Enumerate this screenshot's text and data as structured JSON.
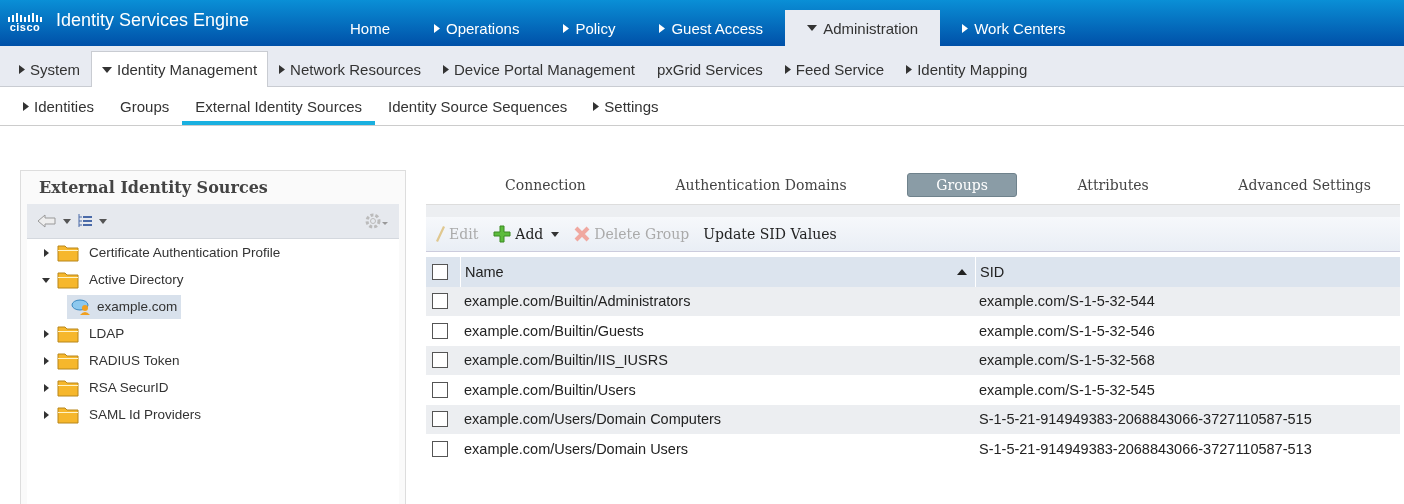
{
  "brand": {
    "logo": "cisco",
    "title": "Identity Services Engine"
  },
  "top_nav": [
    {
      "label": "Home",
      "selected": false
    },
    {
      "label": "Operations",
      "expanded": false,
      "selected": false
    },
    {
      "label": "Policy",
      "expanded": false,
      "selected": false
    },
    {
      "label": "Guest Access",
      "expanded": false,
      "selected": false
    },
    {
      "label": "Administration",
      "expanded": true,
      "selected": true
    },
    {
      "label": "Work Centers",
      "expanded": false,
      "selected": false
    }
  ],
  "second_nav": [
    {
      "label": "System",
      "expanded": false,
      "selected": false
    },
    {
      "label": "Identity Management",
      "expanded": true,
      "selected": true
    },
    {
      "label": "Network Resources",
      "expanded": false,
      "selected": false
    },
    {
      "label": "Device Portal Management",
      "expanded": false,
      "selected": false
    },
    {
      "label": "pxGrid Services",
      "selected": false
    },
    {
      "label": "Feed Service",
      "expanded": false,
      "selected": false
    },
    {
      "label": "Identity Mapping",
      "expanded": false,
      "selected": false
    }
  ],
  "third_nav": [
    {
      "label": "Identities",
      "expanded": false,
      "selected": false
    },
    {
      "label": "Groups",
      "selected": false
    },
    {
      "label": "External Identity Sources",
      "selected": true
    },
    {
      "label": "Identity Source Sequences",
      "selected": false
    },
    {
      "label": "Settings",
      "expanded": false,
      "selected": false
    }
  ],
  "sidebar": {
    "title": "External Identity Sources",
    "items": [
      {
        "label": "Certificate Authentication Profile",
        "expanded": false,
        "selected": false
      },
      {
        "label": "Active Directory",
        "expanded": true,
        "selected": false,
        "children": [
          {
            "label": "example.com",
            "selected": true
          }
        ]
      },
      {
        "label": "LDAP",
        "expanded": false,
        "selected": false
      },
      {
        "label": "RADIUS Token",
        "expanded": false,
        "selected": false
      },
      {
        "label": "RSA SecurID",
        "expanded": false,
        "selected": false
      },
      {
        "label": "SAML Id Providers",
        "expanded": false,
        "selected": false
      }
    ]
  },
  "tabs": [
    {
      "label": "Connection",
      "selected": false
    },
    {
      "label": "Authentication Domains",
      "selected": false
    },
    {
      "label": "Groups",
      "selected": true
    },
    {
      "label": "Attributes",
      "selected": false
    },
    {
      "label": "Advanced Settings",
      "selected": false
    }
  ],
  "toolbar": [
    {
      "kind": "edit",
      "label": "Edit",
      "disabled": true
    },
    {
      "kind": "add",
      "label": "Add",
      "disabled": false
    },
    {
      "kind": "delete",
      "label": "Delete Group",
      "disabled": true
    },
    {
      "kind": "plain",
      "label": "Update SID Values",
      "disabled": false
    }
  ],
  "table": {
    "columns": [
      "Name",
      "SID"
    ],
    "header_checked": false,
    "rows": [
      {
        "checked": false,
        "cells": [
          "example.com/Builtin/Administrators",
          "example.com/S-1-5-32-544"
        ]
      },
      {
        "checked": false,
        "cells": [
          "example.com/Builtin/Guests",
          "example.com/S-1-5-32-546"
        ]
      },
      {
        "checked": false,
        "cells": [
          "example.com/Builtin/IIS_IUSRS",
          "example.com/S-1-5-32-568"
        ]
      },
      {
        "checked": false,
        "cells": [
          "example.com/Builtin/Users",
          "example.com/S-1-5-32-545"
        ]
      },
      {
        "checked": false,
        "cells": [
          "example.com/Users/Domain Computers",
          "S-1-5-21-914949383-2068843066-3727110587-515"
        ]
      },
      {
        "checked": false,
        "cells": [
          "example.com/Users/Domain Users",
          "S-1-5-21-914949383-2068843066-3727110587-513"
        ]
      }
    ]
  }
}
